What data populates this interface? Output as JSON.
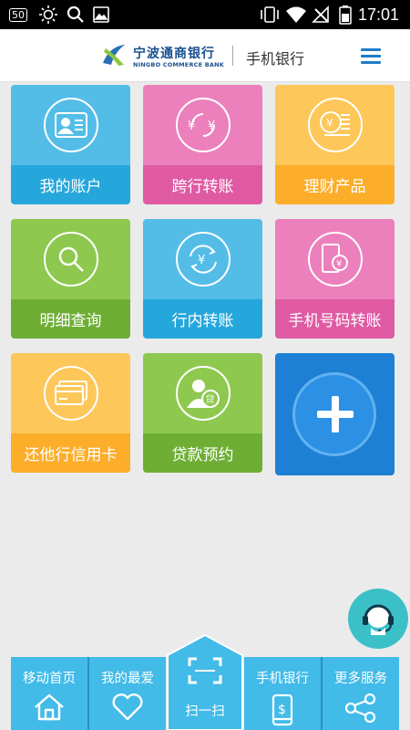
{
  "statusbar": {
    "badge": "50",
    "time": "17:01",
    "icons": [
      "brightness-icon",
      "search-icon",
      "image-icon",
      "vibrate-icon",
      "wifi-icon",
      "no-signal-icon",
      "battery-icon"
    ]
  },
  "header": {
    "brand_cn": "宁波通商银行",
    "brand_en": "NINGBO COMMERCE BANK",
    "title": "手机银行",
    "menu_icon": "menu-icon"
  },
  "tiles": [
    {
      "label": "我的账户",
      "icon": "account-card-icon",
      "color": "#26a7dc"
    },
    {
      "label": "跨行转账",
      "icon": "yuan-exchange-icon",
      "color": "#df5aa3"
    },
    {
      "label": "理财产品",
      "icon": "coin-stack-icon",
      "color": "#fcad2a"
    },
    {
      "label": "明细查询",
      "icon": "search-icon",
      "color": "#6eae35"
    },
    {
      "label": "行内转账",
      "icon": "yuan-refresh-icon",
      "color": "#26a7dc"
    },
    {
      "label": "手机号码转账",
      "icon": "phone-yuan-icon",
      "color": "#df5aa3"
    },
    {
      "label": "还他行信用卡",
      "icon": "credit-card-icon",
      "color": "#fcad2a"
    },
    {
      "label": "贷款预约",
      "icon": "loan-person-icon",
      "badge": "贷",
      "color": "#6eae35"
    }
  ],
  "add_tile": {
    "icon": "plus-icon",
    "color": "#1e80d4"
  },
  "support": {
    "icon": "customer-service-icon",
    "color": "#3cc0c8"
  },
  "bottom_nav": {
    "tabs": [
      {
        "label": "移动首页",
        "icon": "home-icon"
      },
      {
        "label": "我的最爱",
        "icon": "heart-icon"
      },
      {
        "label": "手机银行",
        "icon": "phone-dollar-icon"
      },
      {
        "label": "更多服务",
        "icon": "share-icon"
      }
    ],
    "scan": {
      "label": "扫一扫",
      "icon": "scan-icon"
    },
    "color": "#42bbe8"
  }
}
